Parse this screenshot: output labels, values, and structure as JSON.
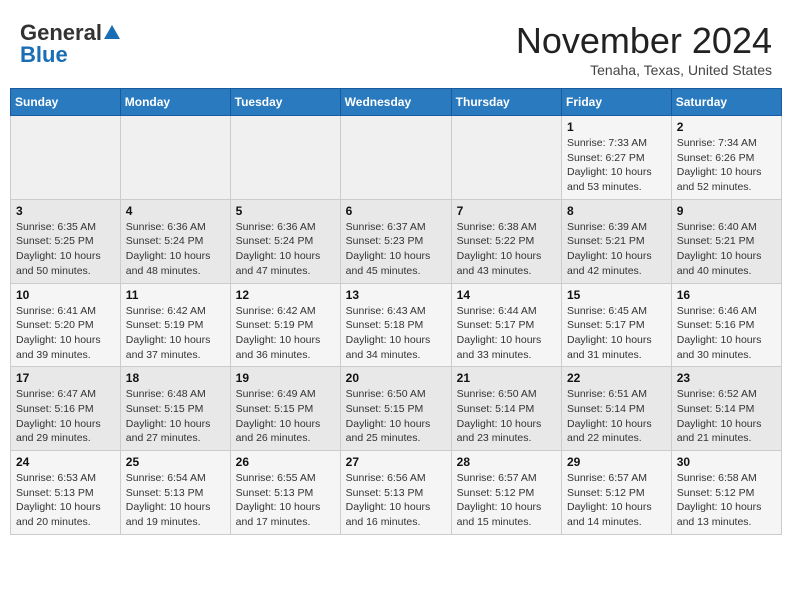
{
  "header": {
    "logo_general": "General",
    "logo_blue": "Blue",
    "month": "November 2024",
    "location": "Tenaha, Texas, United States"
  },
  "weekdays": [
    "Sunday",
    "Monday",
    "Tuesday",
    "Wednesday",
    "Thursday",
    "Friday",
    "Saturday"
  ],
  "weeks": [
    [
      {
        "day": "",
        "info": ""
      },
      {
        "day": "",
        "info": ""
      },
      {
        "day": "",
        "info": ""
      },
      {
        "day": "",
        "info": ""
      },
      {
        "day": "",
        "info": ""
      },
      {
        "day": "1",
        "info": "Sunrise: 7:33 AM\nSunset: 6:27 PM\nDaylight: 10 hours\nand 53 minutes."
      },
      {
        "day": "2",
        "info": "Sunrise: 7:34 AM\nSunset: 6:26 PM\nDaylight: 10 hours\nand 52 minutes."
      }
    ],
    [
      {
        "day": "3",
        "info": "Sunrise: 6:35 AM\nSunset: 5:25 PM\nDaylight: 10 hours\nand 50 minutes."
      },
      {
        "day": "4",
        "info": "Sunrise: 6:36 AM\nSunset: 5:24 PM\nDaylight: 10 hours\nand 48 minutes."
      },
      {
        "day": "5",
        "info": "Sunrise: 6:36 AM\nSunset: 5:24 PM\nDaylight: 10 hours\nand 47 minutes."
      },
      {
        "day": "6",
        "info": "Sunrise: 6:37 AM\nSunset: 5:23 PM\nDaylight: 10 hours\nand 45 minutes."
      },
      {
        "day": "7",
        "info": "Sunrise: 6:38 AM\nSunset: 5:22 PM\nDaylight: 10 hours\nand 43 minutes."
      },
      {
        "day": "8",
        "info": "Sunrise: 6:39 AM\nSunset: 5:21 PM\nDaylight: 10 hours\nand 42 minutes."
      },
      {
        "day": "9",
        "info": "Sunrise: 6:40 AM\nSunset: 5:21 PM\nDaylight: 10 hours\nand 40 minutes."
      }
    ],
    [
      {
        "day": "10",
        "info": "Sunrise: 6:41 AM\nSunset: 5:20 PM\nDaylight: 10 hours\nand 39 minutes."
      },
      {
        "day": "11",
        "info": "Sunrise: 6:42 AM\nSunset: 5:19 PM\nDaylight: 10 hours\nand 37 minutes."
      },
      {
        "day": "12",
        "info": "Sunrise: 6:42 AM\nSunset: 5:19 PM\nDaylight: 10 hours\nand 36 minutes."
      },
      {
        "day": "13",
        "info": "Sunrise: 6:43 AM\nSunset: 5:18 PM\nDaylight: 10 hours\nand 34 minutes."
      },
      {
        "day": "14",
        "info": "Sunrise: 6:44 AM\nSunset: 5:17 PM\nDaylight: 10 hours\nand 33 minutes."
      },
      {
        "day": "15",
        "info": "Sunrise: 6:45 AM\nSunset: 5:17 PM\nDaylight: 10 hours\nand 31 minutes."
      },
      {
        "day": "16",
        "info": "Sunrise: 6:46 AM\nSunset: 5:16 PM\nDaylight: 10 hours\nand 30 minutes."
      }
    ],
    [
      {
        "day": "17",
        "info": "Sunrise: 6:47 AM\nSunset: 5:16 PM\nDaylight: 10 hours\nand 29 minutes."
      },
      {
        "day": "18",
        "info": "Sunrise: 6:48 AM\nSunset: 5:15 PM\nDaylight: 10 hours\nand 27 minutes."
      },
      {
        "day": "19",
        "info": "Sunrise: 6:49 AM\nSunset: 5:15 PM\nDaylight: 10 hours\nand 26 minutes."
      },
      {
        "day": "20",
        "info": "Sunrise: 6:50 AM\nSunset: 5:15 PM\nDaylight: 10 hours\nand 25 minutes."
      },
      {
        "day": "21",
        "info": "Sunrise: 6:50 AM\nSunset: 5:14 PM\nDaylight: 10 hours\nand 23 minutes."
      },
      {
        "day": "22",
        "info": "Sunrise: 6:51 AM\nSunset: 5:14 PM\nDaylight: 10 hours\nand 22 minutes."
      },
      {
        "day": "23",
        "info": "Sunrise: 6:52 AM\nSunset: 5:14 PM\nDaylight: 10 hours\nand 21 minutes."
      }
    ],
    [
      {
        "day": "24",
        "info": "Sunrise: 6:53 AM\nSunset: 5:13 PM\nDaylight: 10 hours\nand 20 minutes."
      },
      {
        "day": "25",
        "info": "Sunrise: 6:54 AM\nSunset: 5:13 PM\nDaylight: 10 hours\nand 19 minutes."
      },
      {
        "day": "26",
        "info": "Sunrise: 6:55 AM\nSunset: 5:13 PM\nDaylight: 10 hours\nand 17 minutes."
      },
      {
        "day": "27",
        "info": "Sunrise: 6:56 AM\nSunset: 5:13 PM\nDaylight: 10 hours\nand 16 minutes."
      },
      {
        "day": "28",
        "info": "Sunrise: 6:57 AM\nSunset: 5:12 PM\nDaylight: 10 hours\nand 15 minutes."
      },
      {
        "day": "29",
        "info": "Sunrise: 6:57 AM\nSunset: 5:12 PM\nDaylight: 10 hours\nand 14 minutes."
      },
      {
        "day": "30",
        "info": "Sunrise: 6:58 AM\nSunset: 5:12 PM\nDaylight: 10 hours\nand 13 minutes."
      }
    ]
  ]
}
